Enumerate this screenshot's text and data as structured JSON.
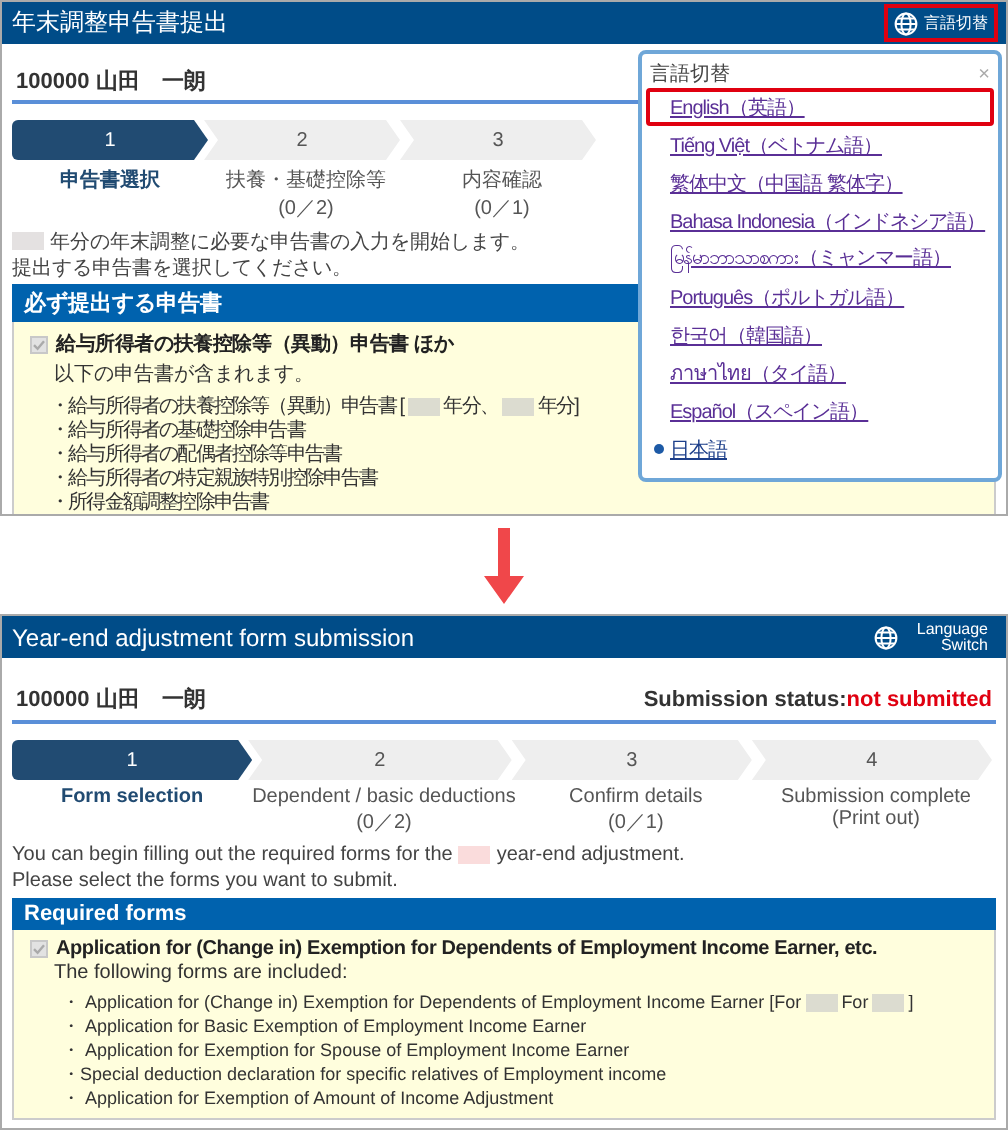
{
  "panels": [
    {
      "header": {
        "title": "年末調整申告書提出",
        "language_button": "言語切替",
        "highlighted": true
      },
      "user": "100000  山田　一朗",
      "steps": [
        {
          "number": "1",
          "label": "申告書選択",
          "selected": true
        },
        {
          "number": "2",
          "label": "扶養・基礎控除等",
          "count": "(0／2)",
          "selected": false
        },
        {
          "number": "3",
          "label": "内容確認",
          "count": "(0／1)",
          "selected": false
        }
      ],
      "intro": [
        [
          {
            "kind": "blank",
            "color": "#e4e1e1"
          },
          {
            "kind": "text",
            "text": "年分の年末調整に必要な申告書の入力を開始します。"
          }
        ],
        [
          {
            "kind": "text",
            "text": "提出する申告書を選択してください。"
          }
        ]
      ],
      "section": {
        "title": "必ず提出する申告書",
        "item": {
          "checked": true,
          "disabled": true,
          "title": "給与所得者の扶養控除等（異動）申告書 ほか",
          "subtitle": "以下の申告書が含まれます。",
          "bullets": [
            [
              {
                "kind": "text",
                "text": "・給与所得者の扶養控除等（異動）申告書 ["
              },
              {
                "kind": "blank",
                "color": "#dcdcd0"
              },
              {
                "kind": "text",
                "text": "年分、"
              },
              {
                "kind": "blank",
                "color": "#dcdcd0"
              },
              {
                "kind": "text",
                "text": "年分]"
              }
            ],
            [
              {
                "kind": "text",
                "text": "・給与所得者の基礎控除申告書"
              }
            ],
            [
              {
                "kind": "text",
                "text": "・給与所得者の配偶者控除等申告書"
              }
            ],
            [
              {
                "kind": "text",
                "text": "・給与所得者の特定親族特別控除申告書"
              }
            ],
            [
              {
                "kind": "text",
                "text": "・所得金額調整控除申告書"
              }
            ]
          ]
        }
      },
      "dropdown": {
        "title": "言語切替",
        "close": "×",
        "languages": [
          {
            "label": "English（英語）",
            "selected": false,
            "highlighted": true
          },
          {
            "label": "Tiếng Việt（ベトナム語）",
            "selected": false,
            "highlighted": false
          },
          {
            "label": "繁体中文（中国語 繁体字）",
            "selected": false,
            "highlighted": false
          },
          {
            "label": "Bahasa Indonesia（インドネシア語）",
            "selected": false,
            "highlighted": false
          },
          {
            "label": "မြန်မာဘာသာစကား（ミャンマー語）",
            "selected": false,
            "highlighted": false
          },
          {
            "label": "Português（ポルトガル語）",
            "selected": false,
            "highlighted": false
          },
          {
            "label": "한국어（韓国語）",
            "selected": false,
            "highlighted": false
          },
          {
            "label": "ภาษาไทย（タイ語）",
            "selected": false,
            "highlighted": false
          },
          {
            "label": "Español（スペイン語）",
            "selected": false,
            "highlighted": false
          },
          {
            "label": "日本語",
            "selected": true,
            "highlighted": false
          }
        ]
      }
    },
    {
      "header": {
        "title": "Year-end adjustment form submission",
        "language_button": "Language Switch",
        "highlighted": false
      },
      "user": "100000  山田　一朗",
      "status": {
        "label": "Submission status:",
        "value": "not submitted"
      },
      "steps": [
        {
          "number": "1",
          "label": "Form selection",
          "selected": true
        },
        {
          "number": "2",
          "label": "Dependent / basic deductions",
          "count": "(0／2)",
          "selected": false
        },
        {
          "number": "3",
          "label": "Confirm details",
          "count": "(0／1)",
          "selected": false
        },
        {
          "number": "4",
          "label": "Submission complete",
          "count": "(Print out)",
          "selected": false
        }
      ],
      "intro": [
        [
          {
            "kind": "text",
            "text": "You can begin filling out the required forms for the"
          },
          {
            "kind": "blank",
            "color": "#fadcdc"
          },
          {
            "kind": "text",
            "text": "year-end adjustment."
          }
        ],
        [
          {
            "kind": "text",
            "text": "Please select the forms you want to submit."
          }
        ]
      ],
      "section": {
        "title": "Required forms",
        "item": {
          "checked": true,
          "disabled": true,
          "title": "Application for (Change in) Exemption for Dependents of Employment Income Earner, etc.",
          "subtitle": "The following forms are included:",
          "bullets": [
            [
              {
                "kind": "text",
                "text": "・ Application for (Change in) Exemption for Dependents of Employment Income Earner [For"
              },
              {
                "kind": "blank",
                "color": "#dcdcd0"
              },
              {
                "kind": "text",
                "text": "For"
              },
              {
                "kind": "blank",
                "color": "#dcdcd0"
              },
              {
                "kind": "text",
                "text": "]"
              }
            ],
            [
              {
                "kind": "text",
                "text": "・ Application for Basic Exemption of Employment Income Earner"
              }
            ],
            [
              {
                "kind": "text",
                "text": "・ Application for Exemption for Spouse of Employment Income Earner"
              }
            ],
            [
              {
                "kind": "text",
                "text": "・Special deduction declaration for specific relatives of Employment income"
              }
            ],
            [
              {
                "kind": "text",
                "text": "・ Application for Exemption of Amount of Income Adjustment"
              }
            ]
          ]
        }
      }
    }
  ]
}
